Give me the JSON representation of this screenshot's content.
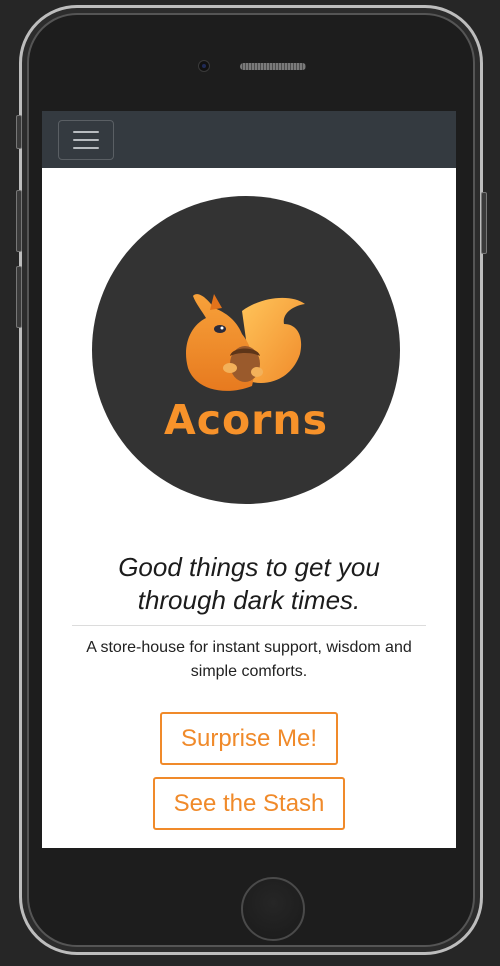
{
  "navbar": {
    "menu_icon": "hamburger-menu-icon"
  },
  "hero": {
    "logo_icon": "squirrel-with-acorn-icon",
    "brand_name": "Acorns"
  },
  "main": {
    "tagline_line1": "Good things to get you",
    "tagline_line2": "through dark times.",
    "subtitle_line1": "A store-house for instant support, wisdom and",
    "subtitle_line2": "simple comforts."
  },
  "actions": {
    "surprise_label": "Surprise Me!",
    "stash_label": "See the Stash"
  },
  "colors": {
    "accent": "#f08a2a",
    "navbar": "#343a40",
    "hero_bg": "#333333"
  }
}
